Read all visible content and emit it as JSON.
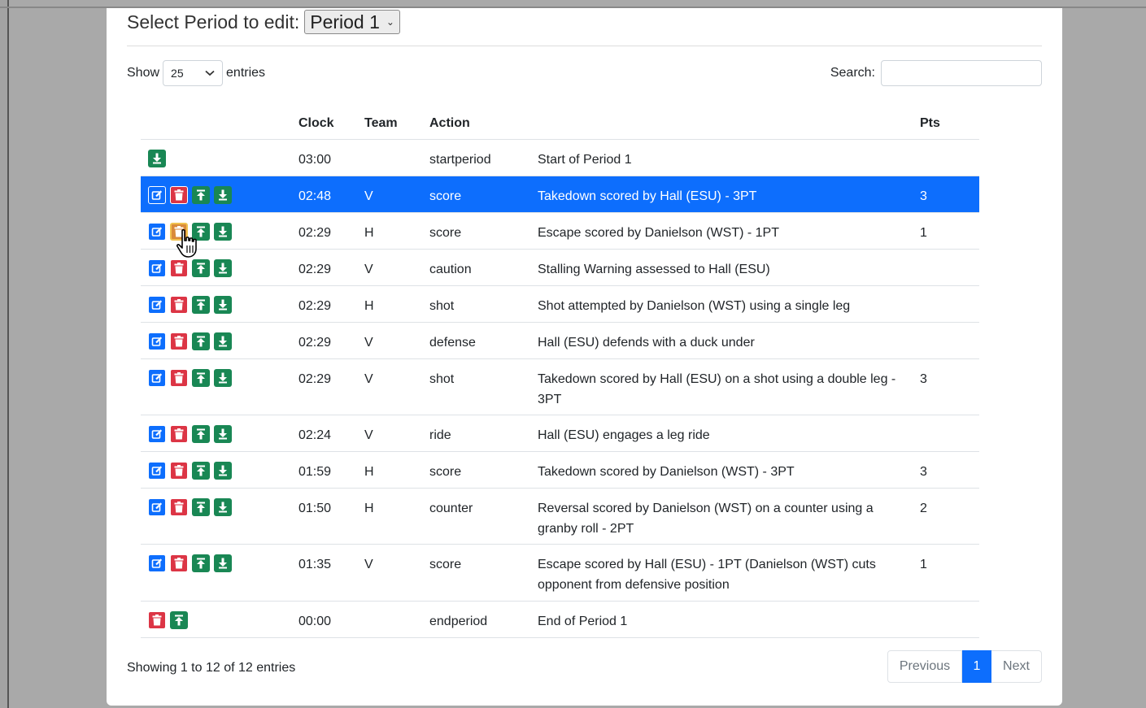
{
  "period": {
    "label": "Select Period to edit:",
    "value": "Period 1"
  },
  "length": {
    "show": "Show",
    "value": "25",
    "entries": "entries"
  },
  "search": {
    "label": "Search:",
    "value": ""
  },
  "columns": {
    "clock": "Clock",
    "team": "Team",
    "action": "Action",
    "desc": "",
    "pts": "Pts"
  },
  "rows": [
    {
      "clock": "03:00",
      "team": "",
      "action": "startperiod",
      "desc": "Start of Period 1",
      "pts": "",
      "buttons": [
        "download"
      ]
    },
    {
      "clock": "02:48",
      "team": "V",
      "action": "score",
      "desc": "Takedown scored by Hall (ESU) - 3PT",
      "pts": "3",
      "buttons": [
        "edit",
        "delete",
        "upload",
        "download"
      ],
      "selected": true
    },
    {
      "clock": "02:29",
      "team": "H",
      "action": "score",
      "desc": "Escape scored by Danielson (WST) - 1PT",
      "pts": "1",
      "buttons": [
        "edit",
        "delete",
        "upload",
        "download"
      ],
      "hover": true
    },
    {
      "clock": "02:29",
      "team": "V",
      "action": "caution",
      "desc": "Stalling Warning assessed to Hall (ESU)",
      "pts": "",
      "buttons": [
        "edit",
        "delete",
        "upload",
        "download"
      ]
    },
    {
      "clock": "02:29",
      "team": "H",
      "action": "shot",
      "desc": "Shot attempted by Danielson (WST) using a single leg",
      "pts": "",
      "buttons": [
        "edit",
        "delete",
        "upload",
        "download"
      ]
    },
    {
      "clock": "02:29",
      "team": "V",
      "action": "defense",
      "desc": "Hall (ESU) defends with a duck under",
      "pts": "",
      "buttons": [
        "edit",
        "delete",
        "upload",
        "download"
      ]
    },
    {
      "clock": "02:29",
      "team": "V",
      "action": "shot",
      "desc": "Takedown scored by Hall (ESU) on a shot using a double leg - 3PT",
      "pts": "3",
      "buttons": [
        "edit",
        "delete",
        "upload",
        "download"
      ]
    },
    {
      "clock": "02:24",
      "team": "V",
      "action": "ride",
      "desc": "Hall (ESU) engages a leg ride",
      "pts": "",
      "buttons": [
        "edit",
        "delete",
        "upload",
        "download"
      ]
    },
    {
      "clock": "01:59",
      "team": "H",
      "action": "score",
      "desc": "Takedown scored by Danielson (WST) - 3PT",
      "pts": "3",
      "buttons": [
        "edit",
        "delete",
        "upload",
        "download"
      ]
    },
    {
      "clock": "01:50",
      "team": "H",
      "action": "counter",
      "desc": "Reversal scored by Danielson (WST) on a counter using a granby roll - 2PT",
      "pts": "2",
      "buttons": [
        "edit",
        "delete",
        "upload",
        "download"
      ]
    },
    {
      "clock": "01:35",
      "team": "V",
      "action": "score",
      "desc": "Escape scored by Hall (ESU) - 1PT (Danielson (WST) cuts opponent from defensive position",
      "pts": "1",
      "buttons": [
        "edit",
        "delete",
        "upload",
        "download"
      ]
    },
    {
      "clock": "00:00",
      "team": "",
      "action": "endperiod",
      "desc": "End of Period 1",
      "pts": "",
      "buttons": [
        "delete",
        "upload"
      ]
    }
  ],
  "info": "Showing 1 to 12 of 12 entries",
  "pagination": {
    "previous": "Previous",
    "current": "1",
    "next": "Next"
  },
  "colors": {
    "primary": "#0d6efd",
    "danger": "#dc3545",
    "success": "#198754",
    "hover": "#d98a3a"
  }
}
